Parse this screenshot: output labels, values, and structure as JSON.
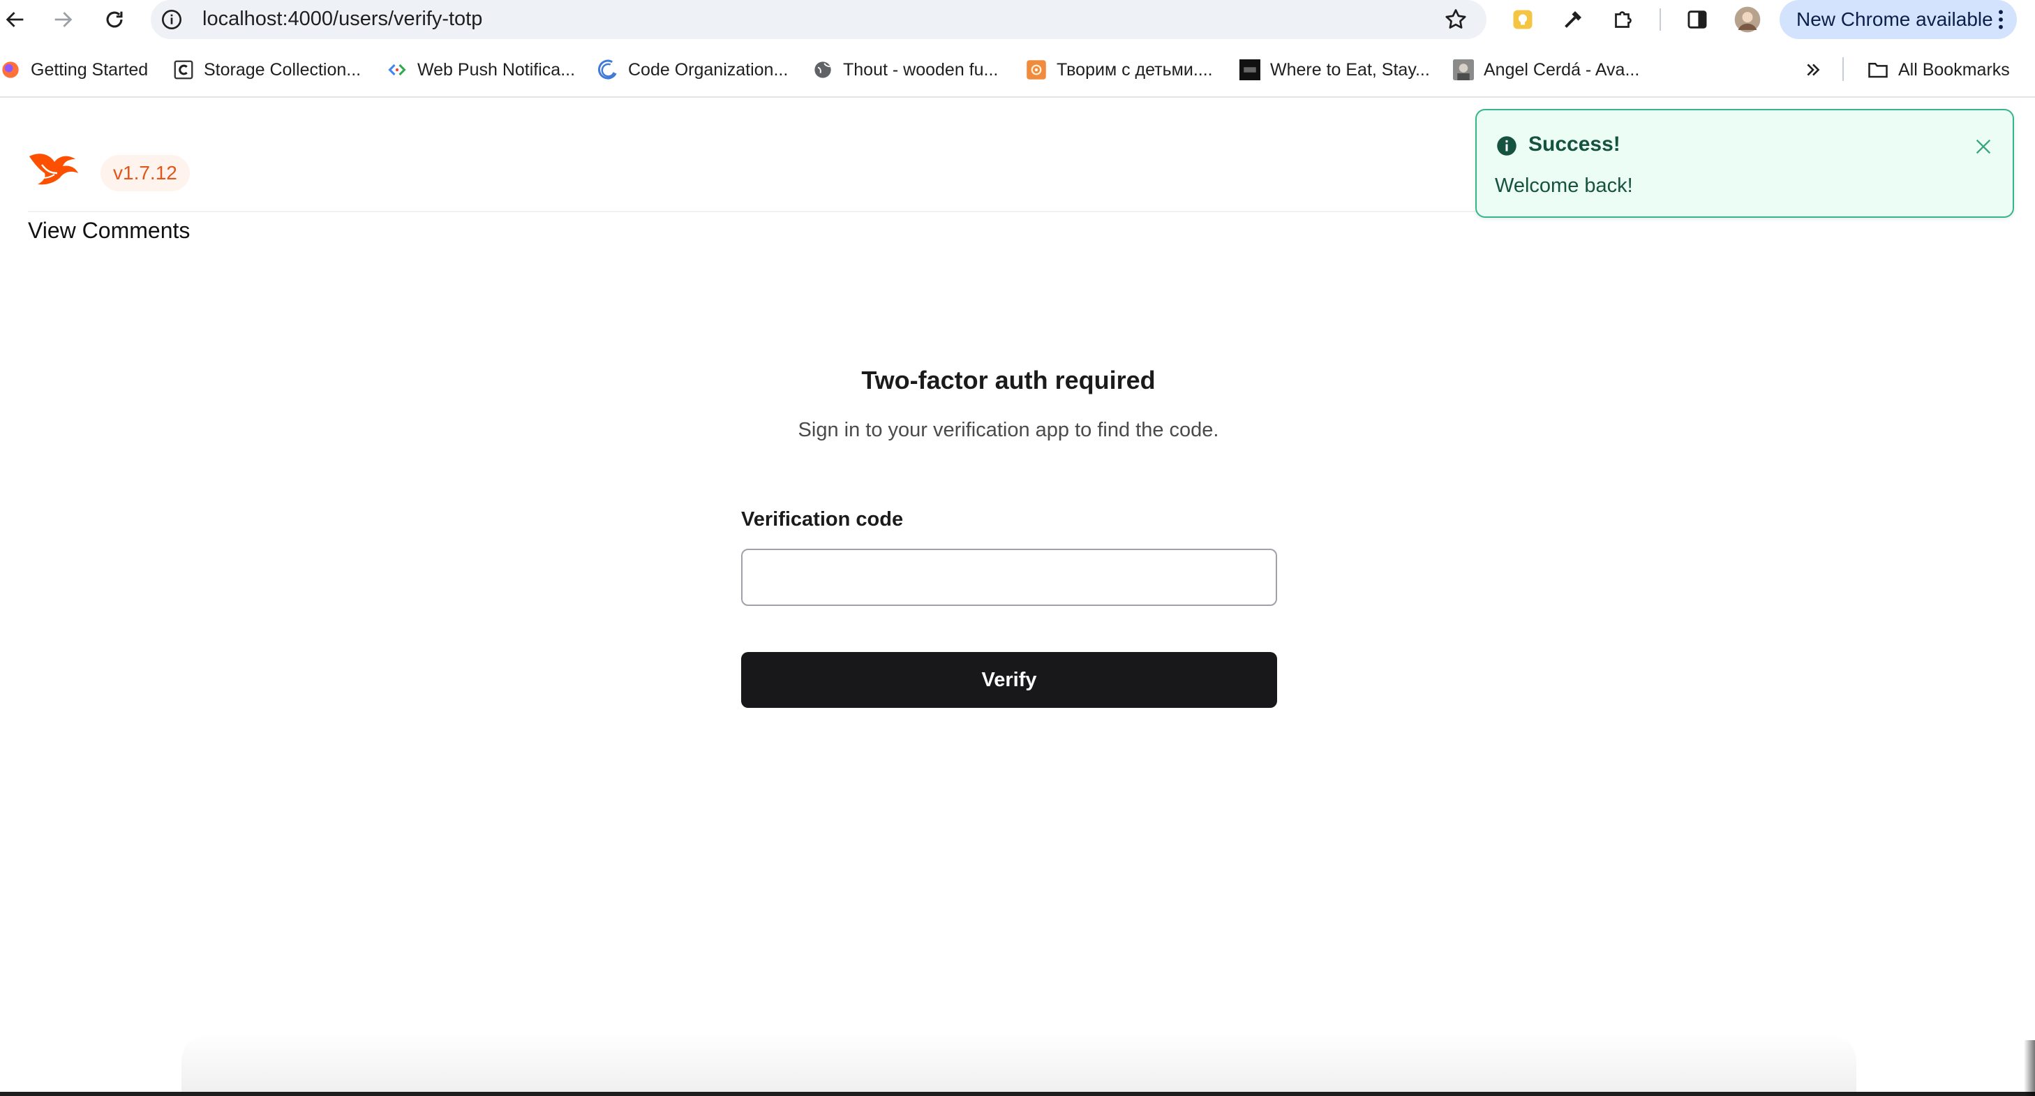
{
  "browser": {
    "url": "localhost:4000/users/verify-totp",
    "update_label": "New Chrome available",
    "bookmarks": [
      {
        "label": "Getting Started",
        "icon": "firefox-icon"
      },
      {
        "label": "Storage Collection...",
        "icon": "c-letter-icon"
      },
      {
        "label": "Web Push Notifica...",
        "icon": "code-chevrons-icon"
      },
      {
        "label": "Code Organization...",
        "icon": "moon-arc-icon"
      },
      {
        "label": "Thout - wooden fu...",
        "icon": "globe-icon"
      },
      {
        "label": "Творим с детьми....",
        "icon": "orange-flower-icon"
      },
      {
        "label": "Where to Eat, Stay...",
        "icon": "cnt-logo-icon"
      },
      {
        "label": "Angel Cerdá - Ava...",
        "icon": "portrait-icon"
      }
    ],
    "all_bookmarks_label": "All Bookmarks"
  },
  "app": {
    "version": "v1.7.12",
    "nav_link": "View Comments"
  },
  "flash": {
    "title": "Success!",
    "message": "Welcome back!",
    "color": "#34b58a"
  },
  "form": {
    "title": "Two-factor auth required",
    "subtitle": "Sign in to your verification app to find the code.",
    "code_label": "Verification code",
    "code_value": "",
    "submit_label": "Verify"
  },
  "colors": {
    "brand": "#e0561c",
    "button": "#18181b",
    "chrome_pill": "#d3e3fd"
  }
}
